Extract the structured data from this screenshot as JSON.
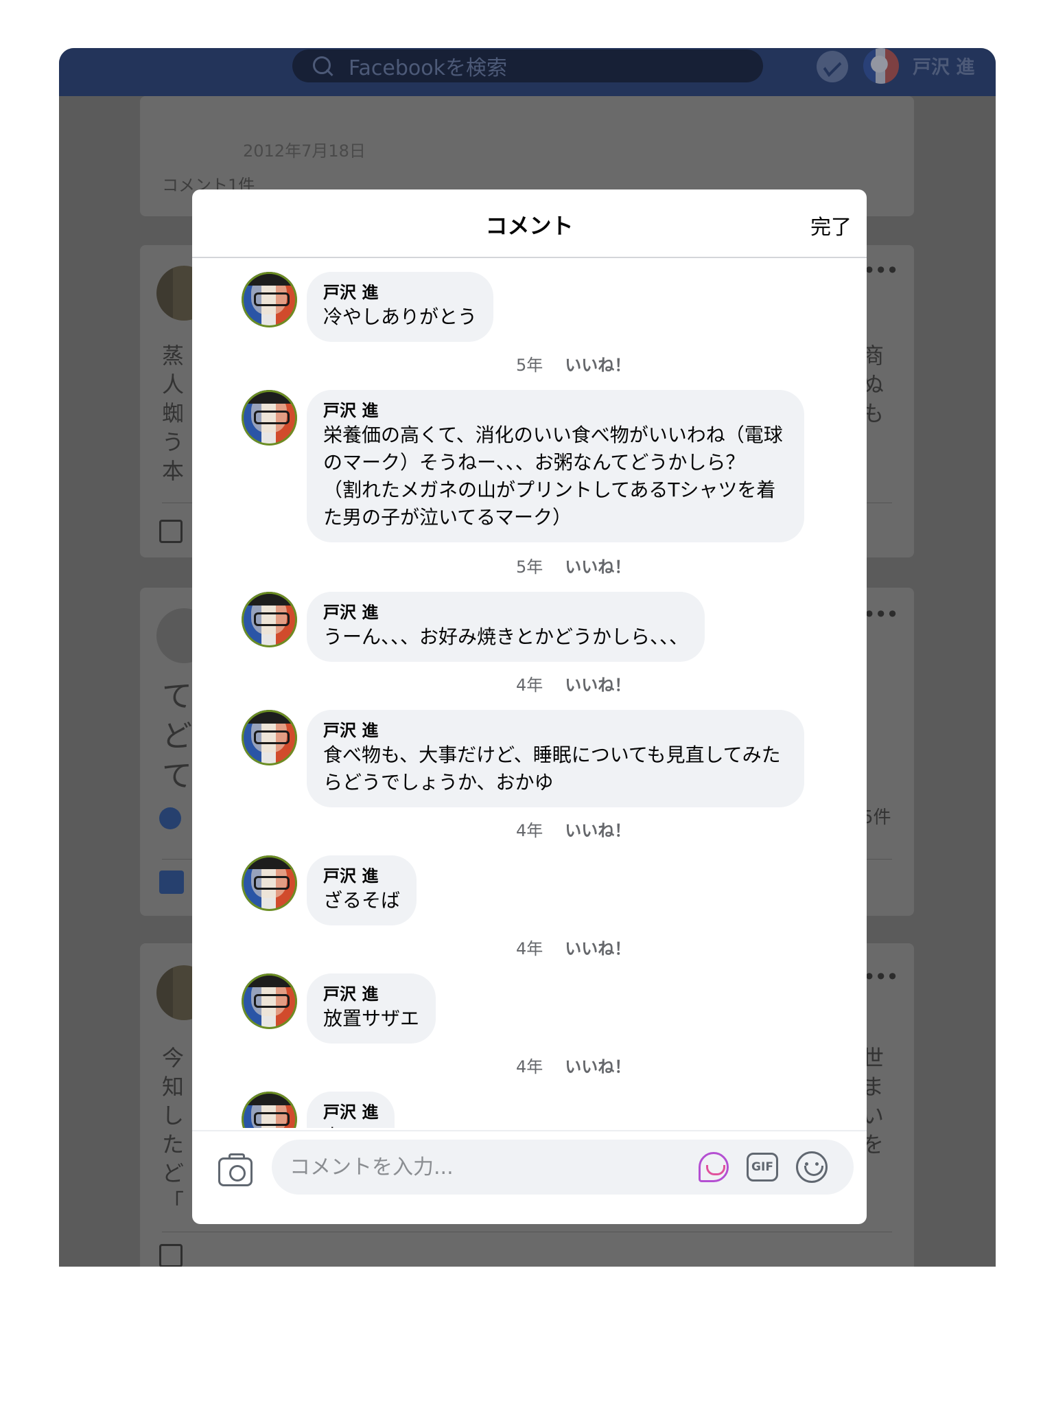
{
  "header": {
    "search_placeholder": "Facebookを検索",
    "username": "戸沢 進"
  },
  "feed": {
    "post1_date": "2012年7月18日",
    "post1_comment_count": "コメント1件",
    "post2_left_chars": "蒸\n人\n蜘\nう\n本",
    "post2_right_chars": "商\nぬ\nも",
    "post3_left_chars": "て\nど\nて",
    "post3_reaction_count": "5件",
    "post4_left_chars": "今\n知\nし\nた\nど\n「",
    "post4_right_chars": "世\nま\nい\nを"
  },
  "modal": {
    "title": "コメント",
    "done_label": "完了",
    "like_label": "いいね！",
    "input_placeholder": "コメントを入力...",
    "gif_label": "GIF",
    "comments": [
      {
        "author": "戸沢 進",
        "text": "冷やしありがとう",
        "time": "5年"
      },
      {
        "author": "戸沢 進",
        "text": "栄養価の高くて、消化のいい食べ物がいいわね（電球\nのマーク）そうねー、、、お粥なんてどうかしら？\n（割れたメガネの山がプリントしてあるTシャツを着\nた男の子が泣いてるマーク）",
        "time": "5年"
      },
      {
        "author": "戸沢 進",
        "text": "うーん、、、お好み焼きとかどうかしら、、、",
        "time": "4年"
      },
      {
        "author": "戸沢 進",
        "text": "食べ物も、大事だけど、睡眠についても見直してみた\nらどうでしょうか、おかゆ",
        "time": "4年"
      },
      {
        "author": "戸沢 進",
        "text": "ざるそば",
        "time": "4年"
      },
      {
        "author": "戸沢 進",
        "text": "放置サザエ",
        "time": "4年"
      },
      {
        "author": "戸沢 進",
        "text": "寿司",
        "time": ""
      }
    ]
  }
}
